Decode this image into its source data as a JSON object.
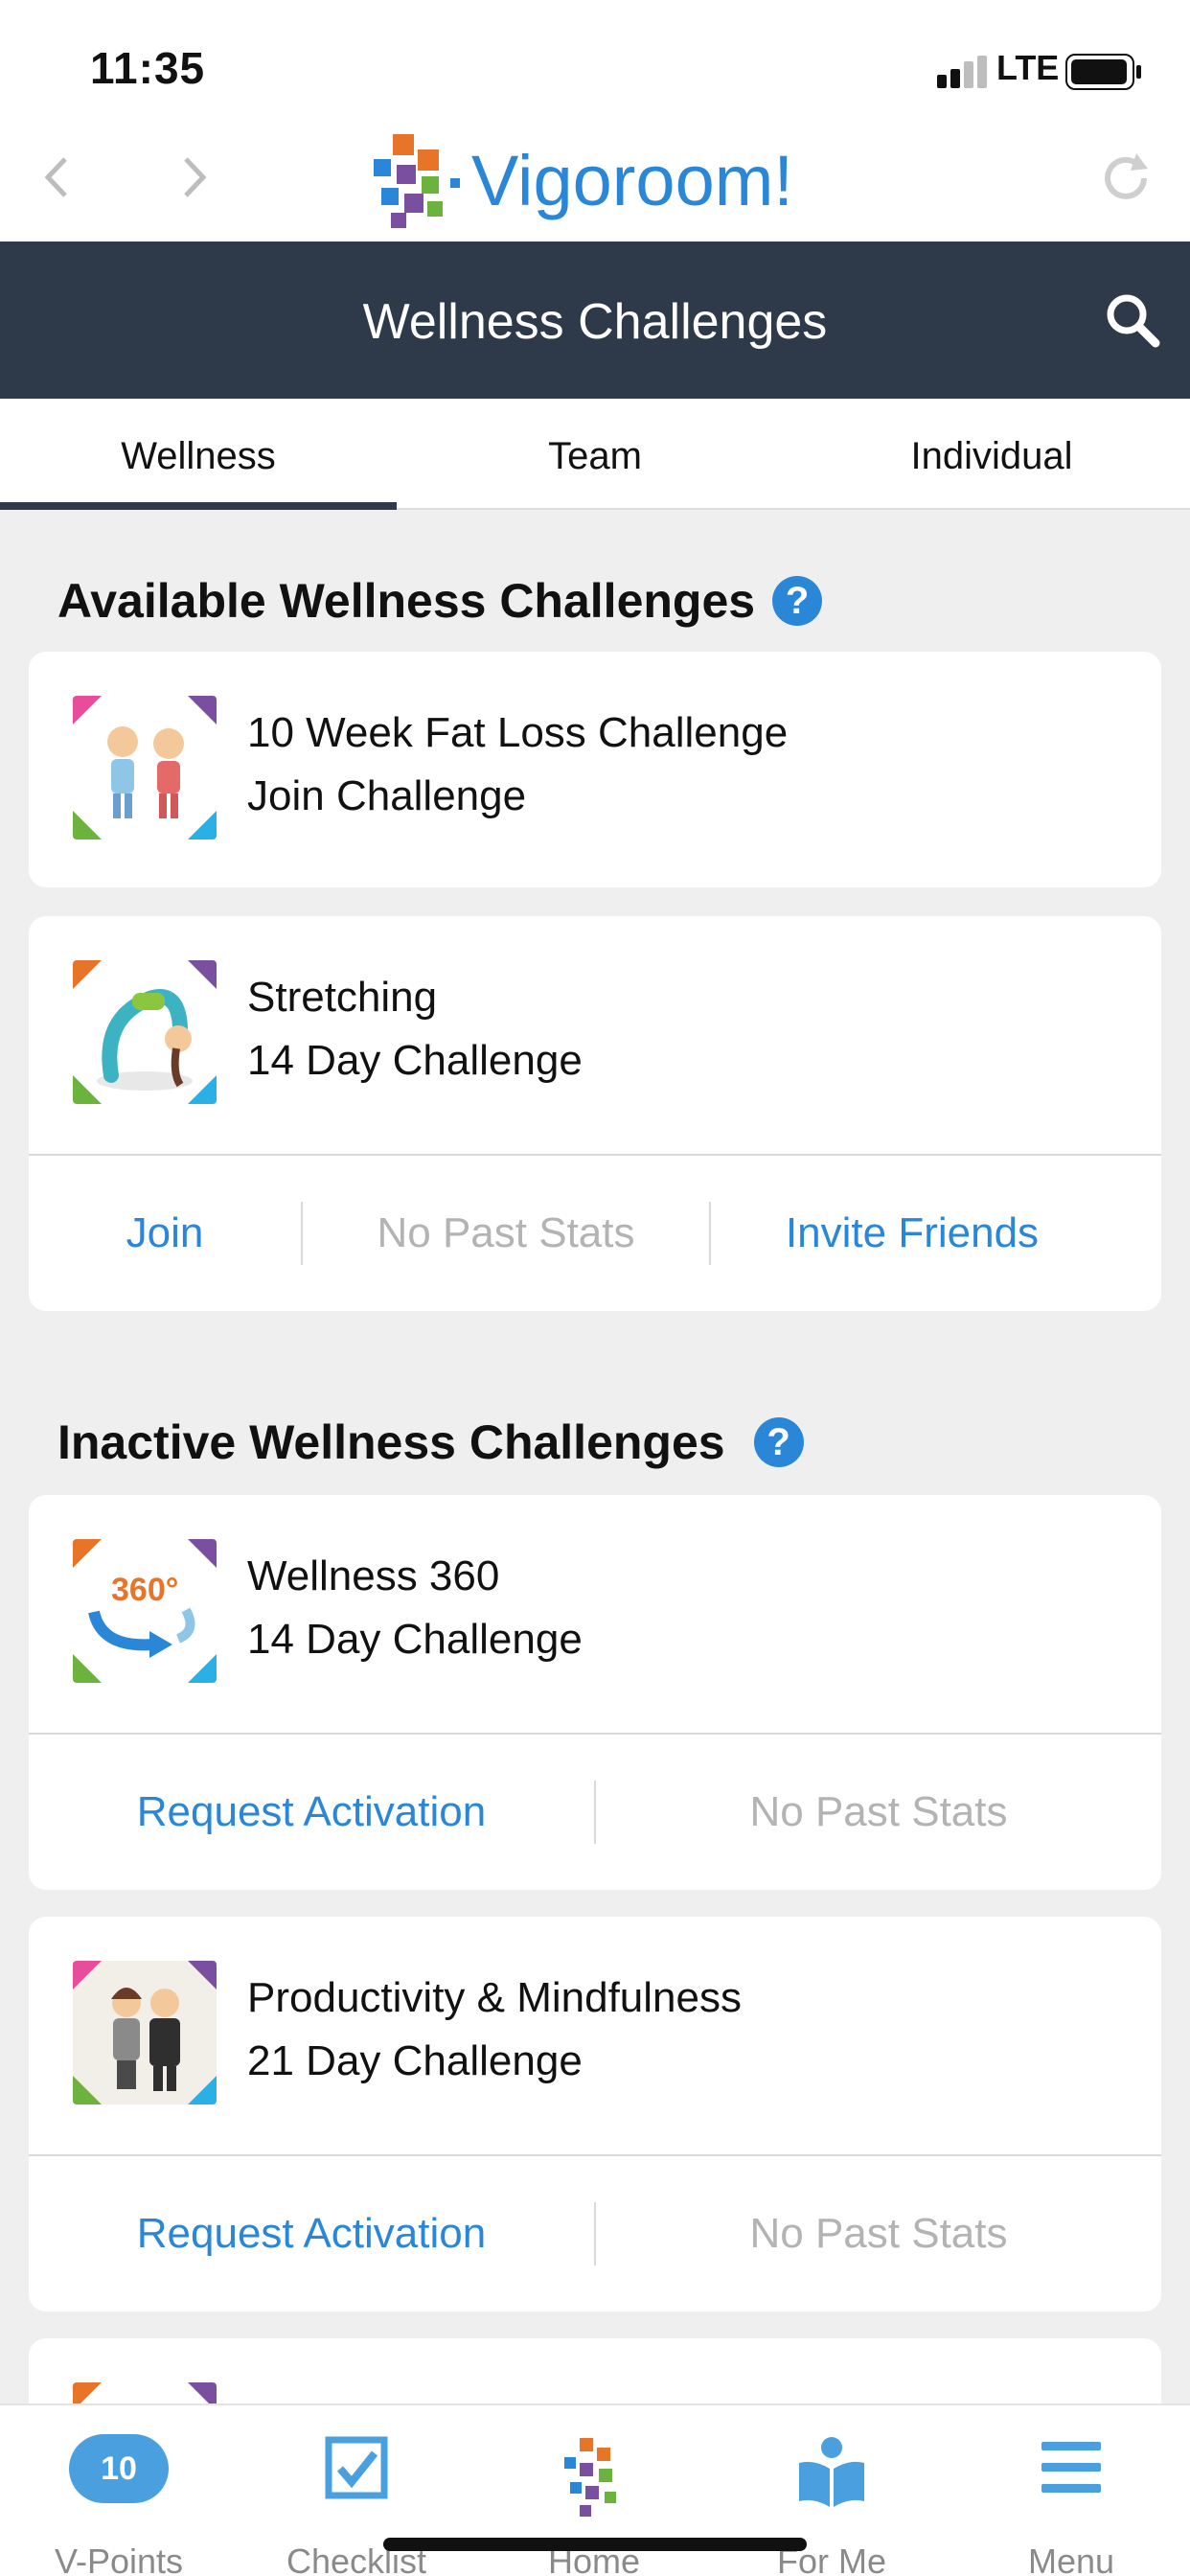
{
  "status_bar": {
    "time": "11:35",
    "network": "LTE"
  },
  "browser": {
    "back_icon": "chevron-left-icon",
    "forward_icon": "chevron-right-icon",
    "logo_text": "Vigoroom!",
    "reload_icon": "reload-icon"
  },
  "header": {
    "title": "Wellness Challenges",
    "search_icon": "search-icon"
  },
  "tabs": [
    {
      "label": "Wellness",
      "active": true
    },
    {
      "label": "Team",
      "active": false
    },
    {
      "label": "Individual",
      "active": false
    }
  ],
  "available": {
    "title": "Available Wellness Challenges",
    "help": "?",
    "items": [
      {
        "name": "10 Week Fat Loss Challenge",
        "sub": "Join Challenge"
      },
      {
        "name": "Stretching",
        "sub": "14 Day Challenge",
        "actions": [
          "Join",
          "No Past Stats",
          "Invite Friends"
        ]
      }
    ]
  },
  "inactive": {
    "title": "Inactive Wellness Challenges",
    "help": "?",
    "items": [
      {
        "name": "Wellness 360",
        "sub": "14 Day Challenge",
        "badge": "360°",
        "actions": [
          "Request Activation",
          "No Past Stats"
        ]
      },
      {
        "name": "Productivity & Mindfulness",
        "sub": "21 Day Challenge",
        "actions": [
          "Request Activation",
          "No Past Stats"
        ]
      }
    ]
  },
  "bottom_nav": [
    {
      "label": "V-Points",
      "badge": "10"
    },
    {
      "label": "Checklist"
    },
    {
      "label": "Home"
    },
    {
      "label": "For Me"
    },
    {
      "label": "Menu"
    }
  ],
  "colors": {
    "header_bg": "#2e3a4a",
    "link": "#2a86d6",
    "muted": "#b3b3b3"
  }
}
